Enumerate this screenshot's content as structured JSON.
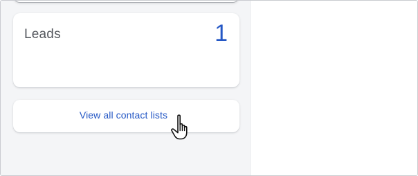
{
  "leads_card": {
    "label": "Leads",
    "count": "1"
  },
  "view_all_button": {
    "label": "View all contact lists"
  },
  "colors": {
    "accent": "#2457c5",
    "panel_bg": "#f4f5f7",
    "card_bg": "#ffffff",
    "label_text": "#55585e"
  },
  "icons": {
    "cursor": "hand-pointer-cursor-icon"
  }
}
